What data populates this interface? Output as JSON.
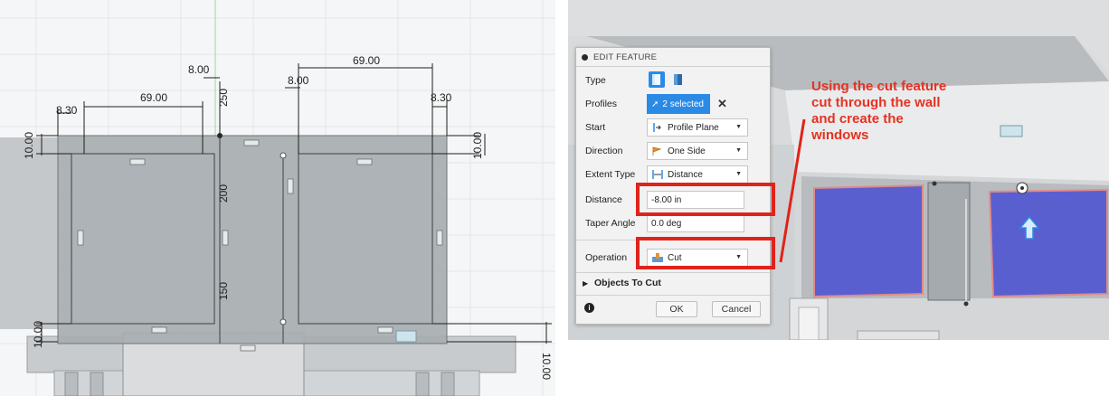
{
  "left_view": {
    "dims": {
      "top_right": "69.00",
      "top_mid_left": "8.00",
      "top_mid_right": "8.00",
      "left_mid": "69.00",
      "left_edge": "8.30",
      "right_edge": "8.30",
      "vert_250": "250",
      "vert_200": "200",
      "vert_150": "150",
      "left_10_top": "10.00",
      "right_10_top": "10.00",
      "left_10_bottom": "10.00",
      "right_10_bottom": "10.00"
    }
  },
  "dialog": {
    "title": "EDIT FEATURE",
    "rows": {
      "type_label": "Type",
      "profiles_label": "Profiles",
      "profiles_value": "2 selected",
      "start_label": "Start",
      "start_value": "Profile Plane",
      "direction_label": "Direction",
      "direction_value": "One Side",
      "extent_label": "Extent Type",
      "extent_value": "Distance",
      "distance_label": "Distance",
      "distance_value": "-8.00 in",
      "taper_label": "Taper Angle",
      "taper_value": "0.0 deg",
      "operation_label": "Operation",
      "operation_value": "Cut"
    },
    "objects_to_cut": "Objects To Cut",
    "ok_label": "OK",
    "cancel_label": "Cancel"
  },
  "annotation": "Using the cut feature cut through the wall and create the windows",
  "colors": {
    "accent_blue": "#2a8ae6",
    "annotation_red": "#e53222",
    "window_blue": "#5a5fd0"
  }
}
